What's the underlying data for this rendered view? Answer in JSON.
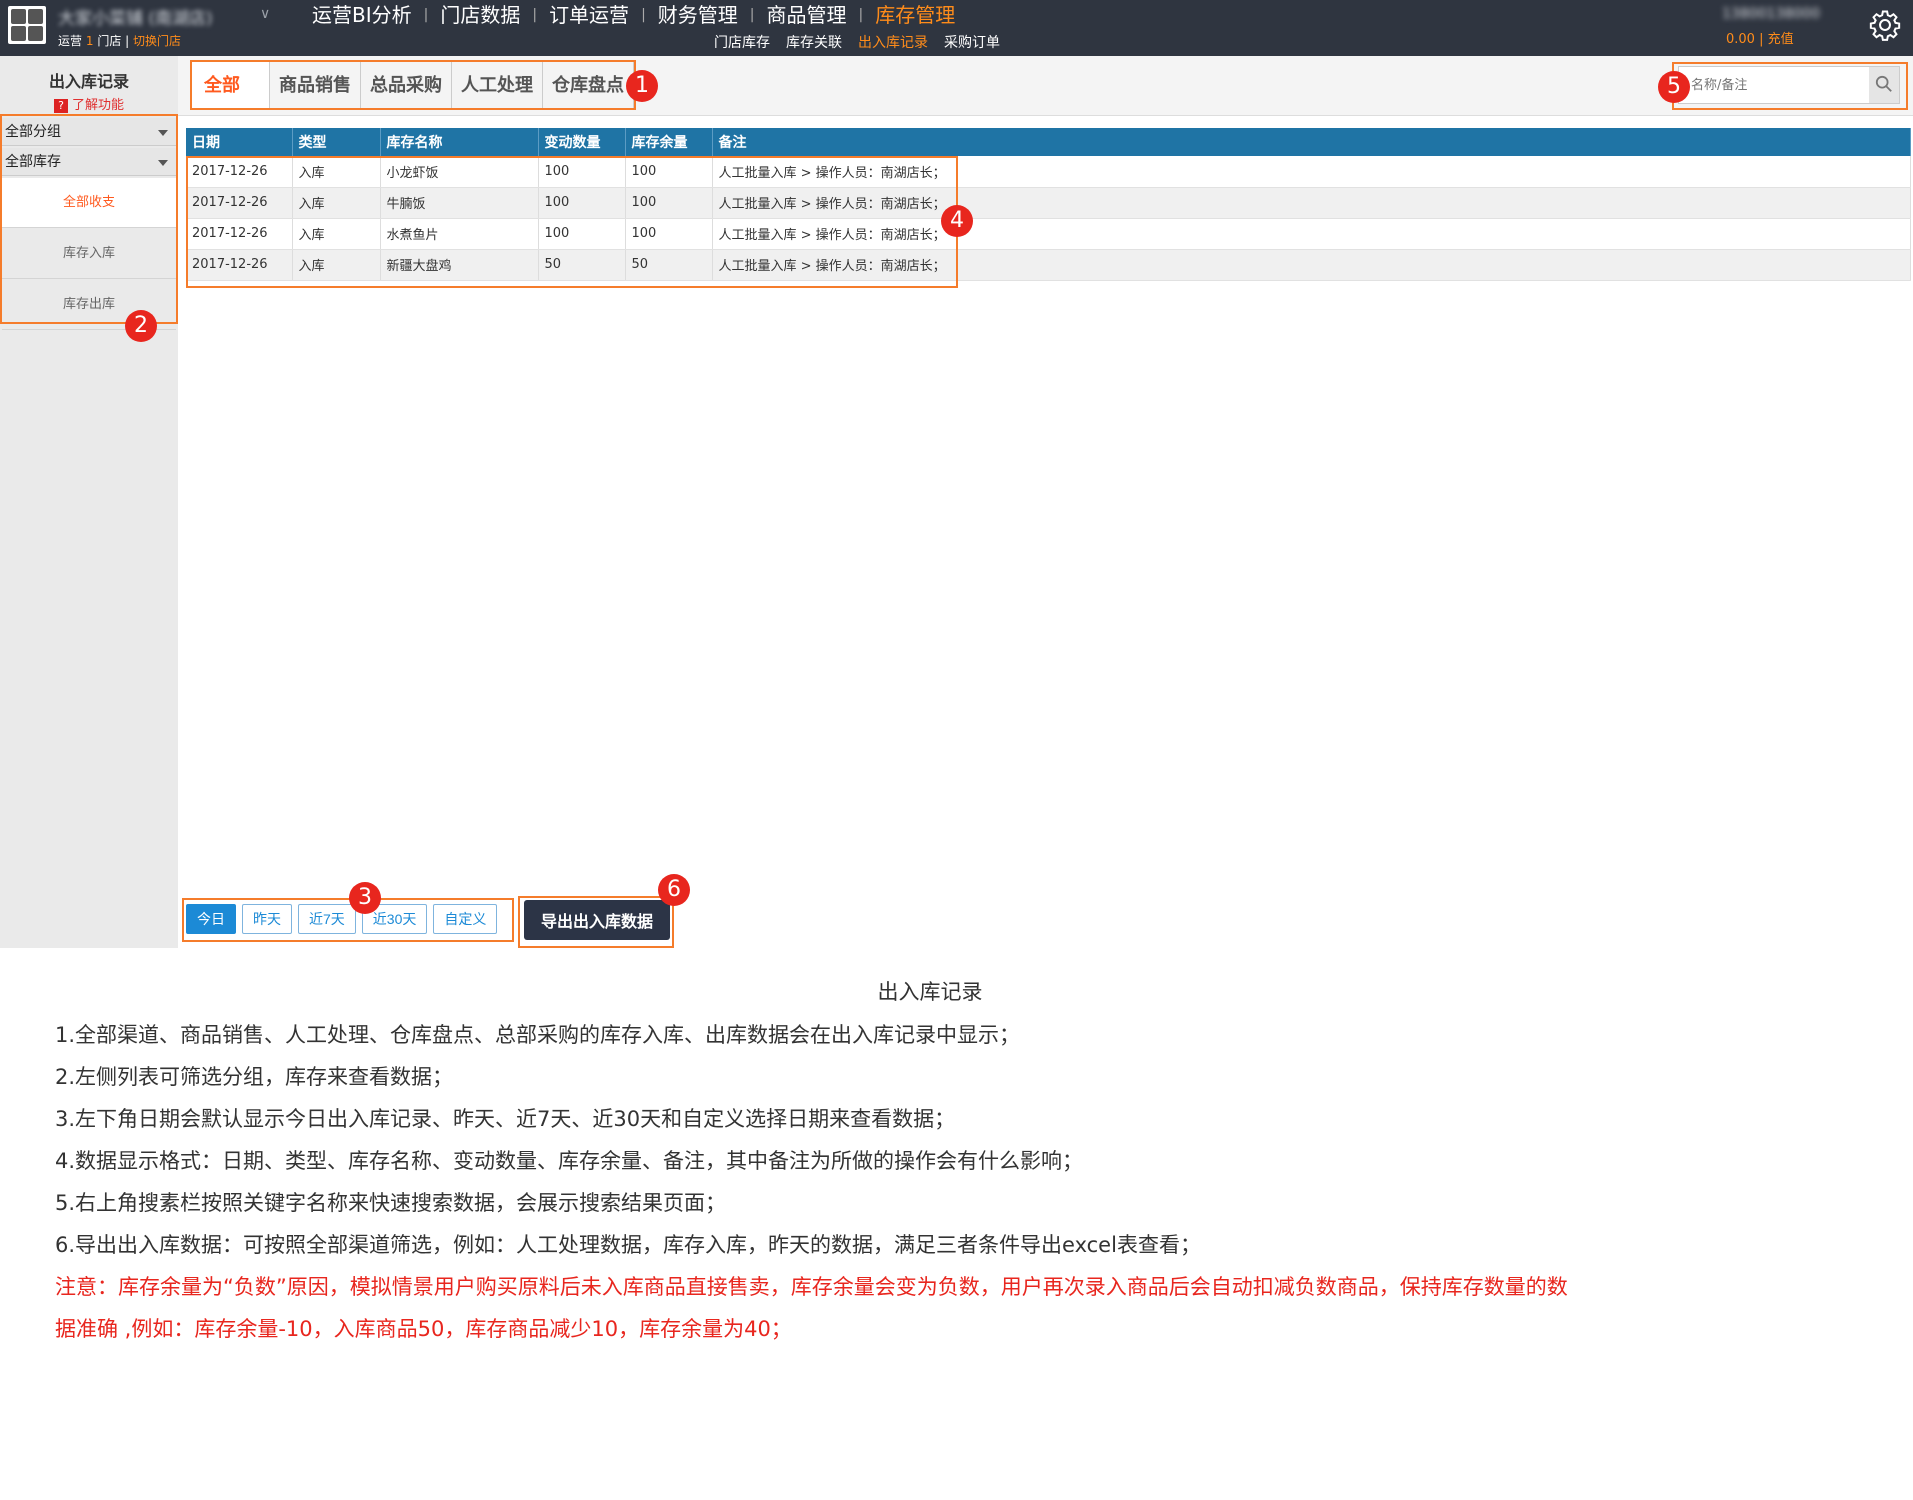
{
  "topbar": {
    "store_name": "大家小菜铺 (南湖店)",
    "ops_prefix": "运营",
    "ops_count": "1",
    "ops_suffix": "门店",
    "switch_store": "切换门店",
    "account": "13800138000",
    "balance": "0.00",
    "recharge": "充值",
    "main_nav": [
      "运营BI分析",
      "门店数据",
      "订单运营",
      "财务管理",
      "商品管理",
      "库存管理"
    ],
    "sub_nav": [
      "门店库存",
      "库存关联",
      "出入库记录",
      "采购订单"
    ]
  },
  "sidebar": {
    "title": "出入库记录",
    "help": "了解功能",
    "help_icon": "?",
    "group_select": "全部分组",
    "stock_select": "全部库存",
    "items": [
      "全部收支",
      "库存入库",
      "库存出库"
    ]
  },
  "tabs": [
    "全部",
    "商品销售",
    "总品采购",
    "人工处理",
    "仓库盘点"
  ],
  "search": {
    "placeholder": "名称/备注",
    "value": ""
  },
  "table": {
    "columns": [
      "日期",
      "类型",
      "库存名称",
      "变动数量",
      "库存余量",
      "备注"
    ],
    "rows": [
      [
        "2017-12-26",
        "入库",
        "小龙虾饭",
        "100",
        "100",
        "人工批量入库 > 操作人员：南湖店长；"
      ],
      [
        "2017-12-26",
        "入库",
        "牛腩饭",
        "100",
        "100",
        "人工批量入库 > 操作人员：南湖店长；"
      ],
      [
        "2017-12-26",
        "入库",
        "水煮鱼片",
        "100",
        "100",
        "人工批量入库 > 操作人员：南湖店长；"
      ],
      [
        "2017-12-26",
        "入库",
        "新疆大盘鸡",
        "50",
        "50",
        "人工批量入库 > 操作人员：南湖店长；"
      ]
    ]
  },
  "date_buttons": [
    "今日",
    "昨天",
    "近7天",
    "近30天",
    "自定义"
  ],
  "export_label": "导出出入库数据",
  "annotations": [
    "1",
    "2",
    "3",
    "4",
    "5",
    "6"
  ],
  "notes": {
    "title": "出入库记录",
    "lines": [
      "1.全部渠道、商品销售、人工处理、仓库盘点、总部采购的库存入库、出库数据会在出入库记录中显示；",
      "2.左侧列表可筛选分组，库存来查看数据；",
      "3.左下角日期会默认显示今日出入库记录、昨天、近7天、近30天和自定义选择日期来查看数据；",
      "4.数据显示格式：日期、类型、库存名称、变动数量、库存余量、备注，其中备注为所做的操作会有什么影响；",
      "5.右上角搜素栏按照关键字名称来快速搜索数据，会展示搜索结果页面；",
      "6.导出出入库数据：可按照全部渠道筛选，例如：人工处理数据，库存入库，昨天的数据，满足三者条件导出excel表查看；"
    ],
    "warning_1": "注意：库存余量为“负数”原因，模拟情景用户购买原料后未入库商品直接售卖，库存余量会变为负数，用户再次录入商品后会自动扣减负数商品，保持库存数量的数",
    "warning_2": "据准确 ,例如：库存余量-10，入库商品50，库存商品减少10，库存余量为40；"
  },
  "colors": {
    "accent": "#ff8c1a",
    "header": "#2f3540",
    "table_head": "#1f74a5",
    "annotation": "#e8261e"
  }
}
